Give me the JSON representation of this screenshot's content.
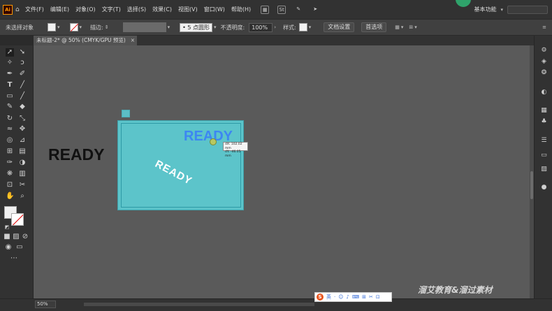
{
  "menubar": {
    "app_logo": "Ai",
    "items": [
      "文件(F)",
      "编辑(E)",
      "对象(O)",
      "文字(T)",
      "选择(S)",
      "效果(C)",
      "视图(V)",
      "窗口(W)",
      "帮助(H)"
    ],
    "quick_icons": [
      "grid-icon",
      "St",
      "brush-icon",
      "send-icon"
    ],
    "workspace_label": "基本功能"
  },
  "controlbar": {
    "selection_label": "未选择对象",
    "stroke_label": "描边:",
    "brush_size": "5 点圆形",
    "opacity_label": "不透明度:",
    "opacity_value": "100%",
    "style_label": "样式:",
    "document_setup": "文档设置",
    "preferences": "首选项"
  },
  "tab": {
    "title": "未标题-2* @ 50% (CMYK/GPU 预览)",
    "close": "×"
  },
  "canvas": {
    "text_left": "READY",
    "text_blue": "READY",
    "text_rotated": "READY",
    "tooltip_line1": "dX: 102.02 mm",
    "tooltip_line2": "dY: -46.05 mm",
    "colors": {
      "pasteboard": "#5a5a5a",
      "artboard_fill": "#5cc4ca",
      "blue_text": "#3d86f2",
      "white_text": "#ffffff",
      "black_text": "#111111"
    }
  },
  "statusbar": {
    "zoom": "50%"
  },
  "ime": {
    "logo": "S",
    "items": [
      "英",
      "·",
      "☺",
      "♪",
      "⌨",
      "⊞",
      "✂",
      "⊡"
    ]
  },
  "watermark": "溜艾教育&溜过素材"
}
